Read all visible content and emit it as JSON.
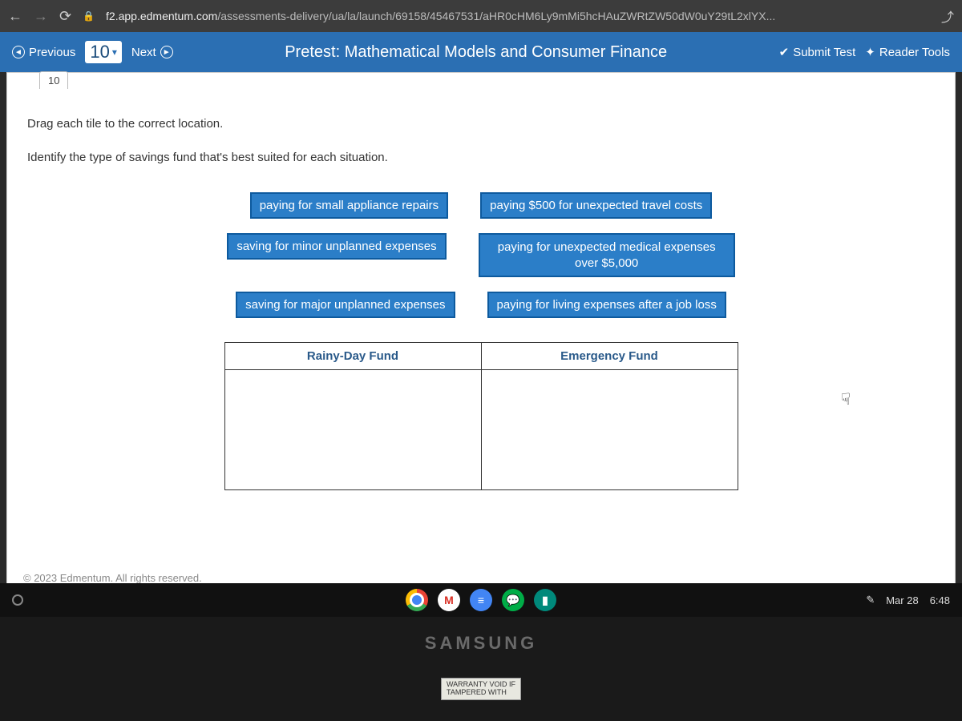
{
  "browser": {
    "url_domain": "f2.app.edmentum.com",
    "url_path": "/assessments-delivery/ua/la/launch/69158/45467531/aHR0cHM6Ly9mMi5hcHAuZWRtZW50dW0uY29tL2xlYX..."
  },
  "header": {
    "previous": "Previous",
    "next": "Next",
    "question_number": "10",
    "title": "Pretest: Mathematical Models and Consumer Finance",
    "submit": "Submit Test",
    "tools": "Reader Tools"
  },
  "question": {
    "tab": "10",
    "instruction": "Drag each tile to the correct location.",
    "prompt": "Identify the type of savings fund that's best suited for each situation.",
    "tiles": [
      [
        "paying for small appliance repairs",
        "paying $500 for unexpected travel costs"
      ],
      [
        "saving for minor unplanned expenses",
        "paying for unexpected medical expenses over $5,000"
      ],
      [
        "saving for major unplanned expenses",
        "paying for living expenses after a job loss"
      ]
    ],
    "drop_headers": [
      "Rainy-Day Fund",
      "Emergency Fund"
    ]
  },
  "footer": {
    "copyright": "© 2023 Edmentum. All rights reserved."
  },
  "taskbar": {
    "date": "Mar 28",
    "time": "6:48"
  },
  "device": {
    "brand": "SAMSUNG",
    "sticker_line1": "WARRANTY VOID IF",
    "sticker_line2": "TAMPERED WITH"
  }
}
